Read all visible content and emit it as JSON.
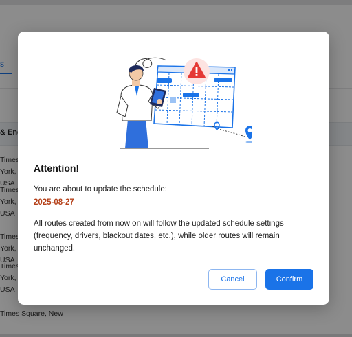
{
  "background": {
    "tab_fragment": "s",
    "column_header": "& End",
    "cells": [
      [
        "Times",
        "York,",
        "USA"
      ],
      [
        "Times",
        "York,",
        "USA"
      ],
      [
        "Times",
        "York,",
        "USA"
      ],
      [
        "Times",
        "York,",
        "USA"
      ]
    ],
    "bottom_cell": "Times Square, New"
  },
  "dialog": {
    "title": "Attention!",
    "lead": "You are about to update the schedule:",
    "date": "2025-08-27",
    "body": "All routes created from now on will follow the updated schedule settings (frequency, drivers, blackout dates, etc.), while older routes will remain unchanged.",
    "cancel_label": "Cancel",
    "confirm_label": "Confirm",
    "illustration_icons": [
      "warning-icon",
      "calendar-icon",
      "location-pin-icon",
      "tablet-icon"
    ]
  },
  "colors": {
    "accent": "#1a73e8",
    "date": "#b5411a",
    "warning": "#e53935",
    "overlay": "rgba(0,0,0,0.45)"
  }
}
